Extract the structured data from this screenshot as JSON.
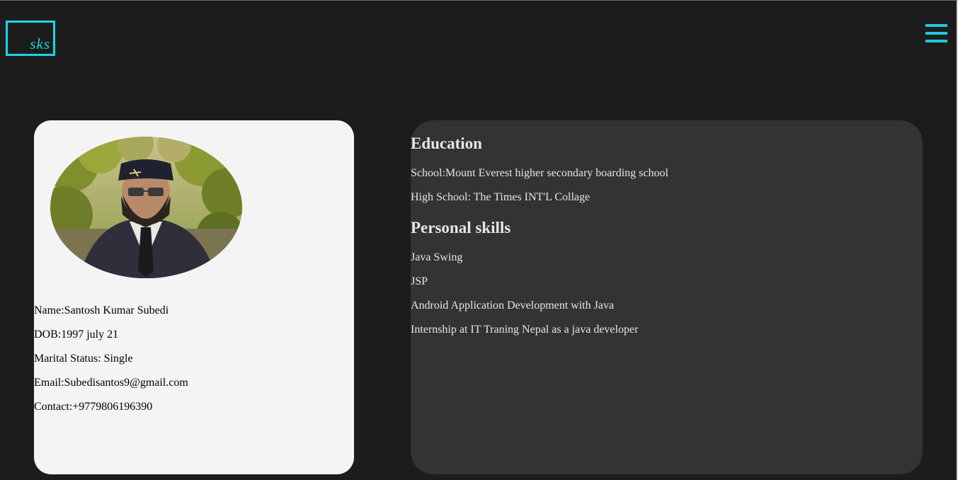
{
  "header": {
    "logo_text": "sks",
    "menu_icon": "hamburger-menu-icon",
    "accent_color": "#16d8e6"
  },
  "profile": {
    "photo": "profile-photo",
    "name": "Name:Santosh Kumar Subedi",
    "dob": "DOB:1997 july 21",
    "marital_status": "Marital Status: Single",
    "email": "Email:Subedisantos9@gmail.com",
    "contact": "Contact:+9779806196390"
  },
  "education": {
    "heading": "Education",
    "items": [
      "School:Mount Everest higher secondary boarding school",
      "High School: The Times INT'L Collage"
    ]
  },
  "skills": {
    "heading": "Personal skills",
    "items": [
      "Java Swing",
      "JSP",
      "Android Application Development with Java",
      "Internship at IT Traning Nepal as a java developer"
    ]
  }
}
